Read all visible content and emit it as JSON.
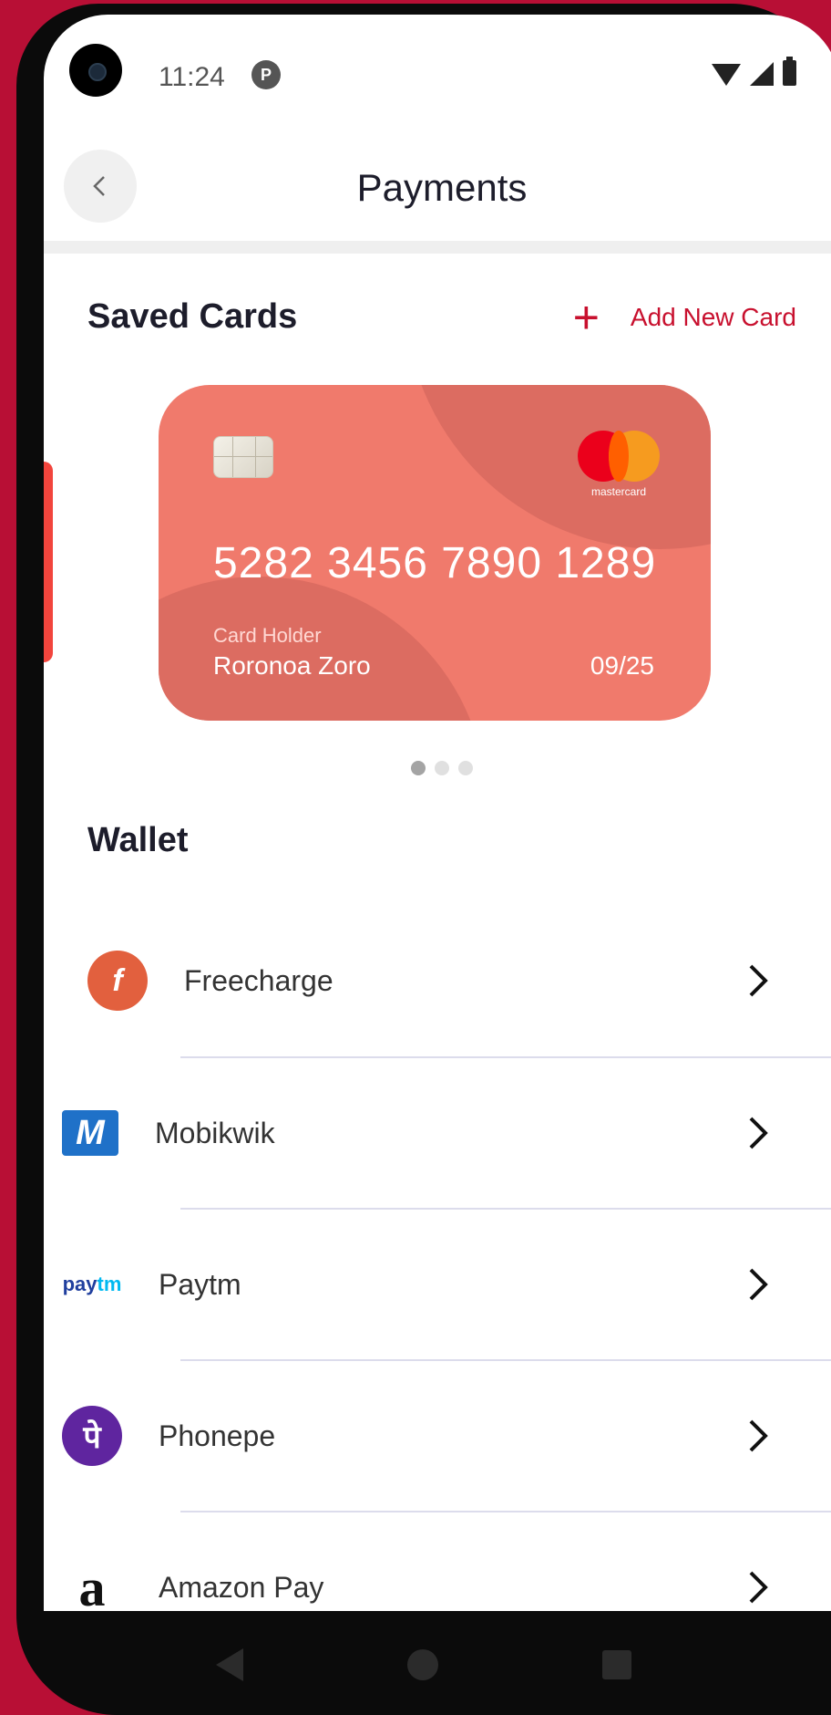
{
  "status_bar": {
    "time": "11:24"
  },
  "header": {
    "title": "Payments"
  },
  "saved_cards": {
    "title": "Saved Cards",
    "add_label": "Add New Card",
    "card": {
      "number": "5282 3456 7890 1289",
      "holder_label": "Card Holder",
      "holder_name": "Roronoa Zoro",
      "expiry": "09/25",
      "network": "mastercard"
    },
    "pager": {
      "count": 3,
      "active_index": 0
    }
  },
  "wallet": {
    "title": "Wallet",
    "items": [
      {
        "name": "Freecharge",
        "icon": "freecharge-icon",
        "color": "#e2603e"
      },
      {
        "name": "Mobikwik",
        "icon": "mobikwik-icon",
        "color": "#1f71c8"
      },
      {
        "name": "Paytm",
        "icon": "paytm-icon",
        "color": "#203f9e"
      },
      {
        "name": "Phonepe",
        "icon": "phonepe-icon",
        "color": "#5f259f"
      },
      {
        "name": "Amazon Pay",
        "icon": "amazon-icon",
        "color": "#111111"
      }
    ]
  },
  "colors": {
    "accent": "#c8102e",
    "card": "#f07a6c",
    "background": "#b80f35"
  }
}
